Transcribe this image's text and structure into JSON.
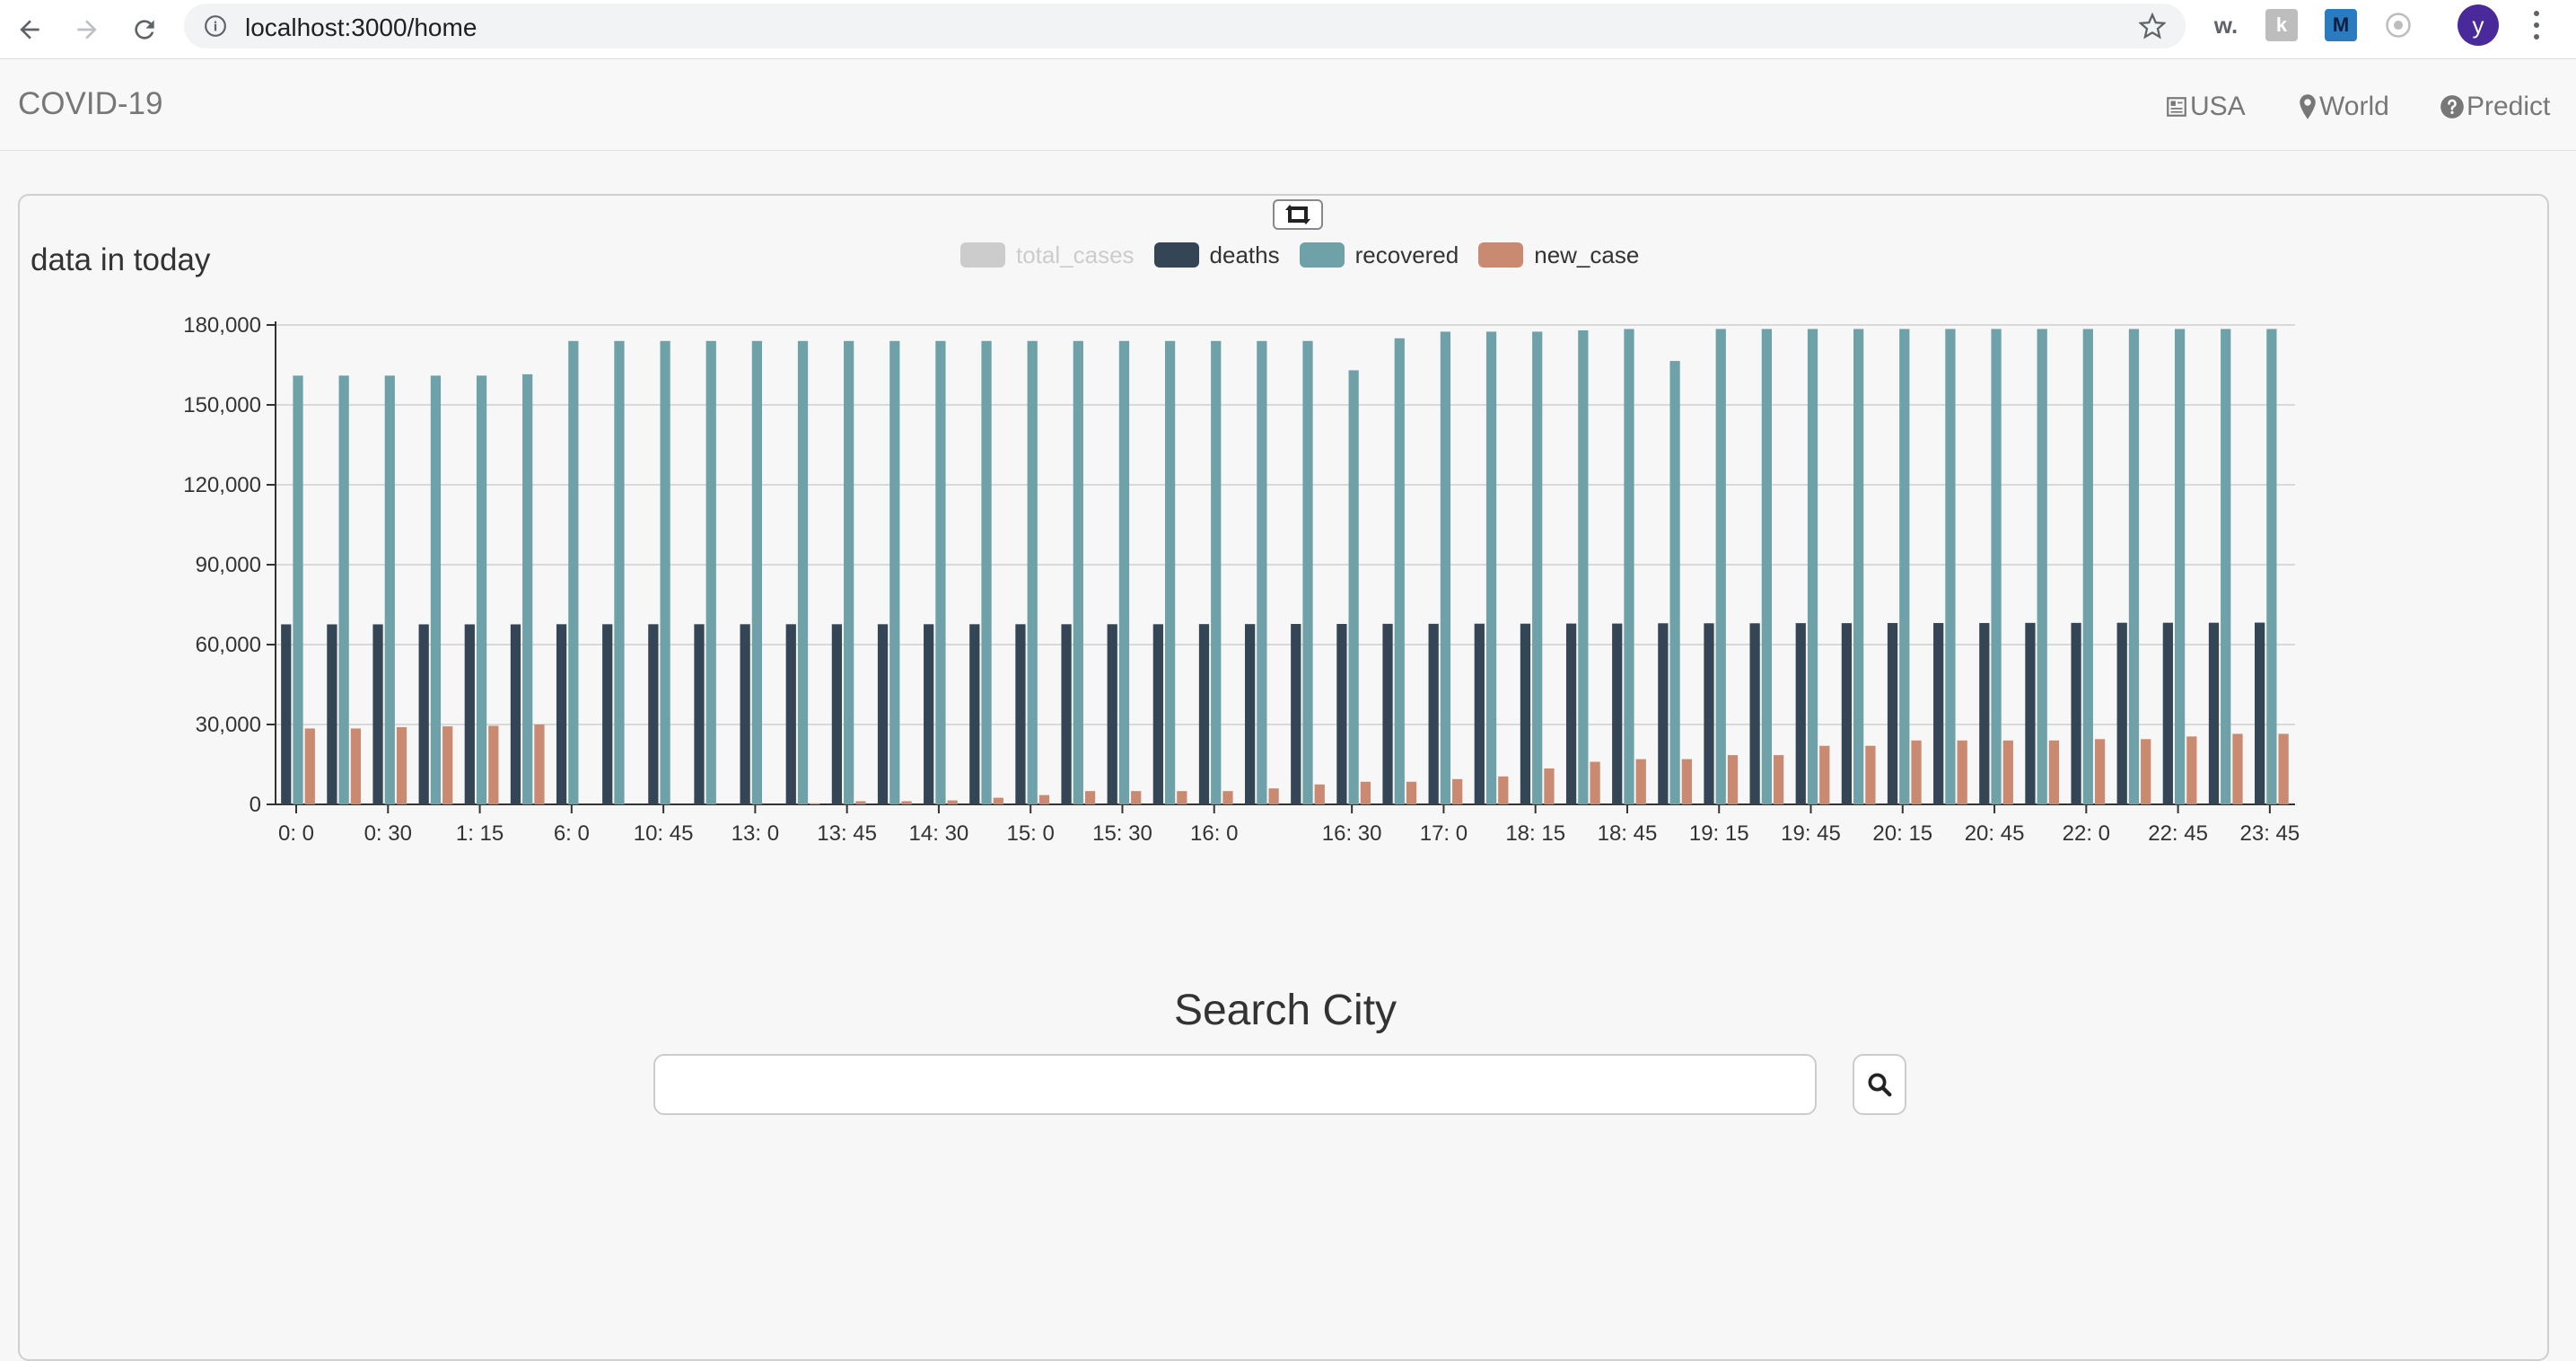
{
  "browser": {
    "url": "localhost:3000/home",
    "avatar_letter": "y",
    "extensions": [
      "w-extension-icon",
      "k-extension-icon",
      "m-extension-icon",
      "circle-extension-icon"
    ]
  },
  "navbar": {
    "brand": "COVID-19",
    "links": [
      {
        "label": "USA",
        "icon": "newspaper-icon"
      },
      {
        "label": "World",
        "icon": "map-marker-icon"
      },
      {
        "label": "Predict",
        "icon": "question-circle-icon"
      }
    ]
  },
  "panel": {
    "title": "data in today",
    "refresh_icon": "retweet-icon"
  },
  "search": {
    "title": "Search City",
    "placeholder": "",
    "value": ""
  },
  "colors": {
    "total_cases": "#cccccc",
    "deaths": "#344656",
    "recovered": "#6fa2a8",
    "new_case": "#c98a71"
  },
  "chart_data": {
    "type": "bar",
    "title": "",
    "xlabel": "",
    "ylabel": "",
    "ylim": [
      0,
      180000
    ],
    "y_ticks": [
      "0",
      "30,000",
      "60,000",
      "90,000",
      "120,000",
      "150,000",
      "180,000"
    ],
    "x_tick_labels": [
      "0: 0",
      "0: 30",
      "1: 15",
      "6: 0",
      "10: 45",
      "13: 0",
      "13: 45",
      "14: 30",
      "15: 0",
      "15: 30",
      "16: 0",
      "16: 30",
      "17: 0",
      "18: 15",
      "18: 45",
      "19: 15",
      "19: 45",
      "20: 15",
      "20: 45",
      "22: 0",
      "22: 45",
      "23: 45"
    ],
    "legend": [
      {
        "name": "total_cases",
        "color": "#cccccc",
        "disabled": true
      },
      {
        "name": "deaths",
        "color": "#344656"
      },
      {
        "name": "recovered",
        "color": "#6fa2a8"
      },
      {
        "name": "new_case",
        "color": "#c98a71"
      }
    ],
    "category_count": 44,
    "series": [
      {
        "name": "deaths",
        "values": [
          67600,
          67600,
          67600,
          67600,
          67600,
          67600,
          67650,
          67650,
          67650,
          67650,
          67650,
          67650,
          67650,
          67650,
          67650,
          67650,
          67650,
          67650,
          67650,
          67650,
          67700,
          67700,
          67750,
          67750,
          67800,
          67800,
          67850,
          67850,
          67900,
          67900,
          68000,
          68000,
          68000,
          68050,
          68050,
          68100,
          68100,
          68100,
          68150,
          68150,
          68200,
          68200,
          68200,
          68250
        ]
      },
      {
        "name": "recovered",
        "values": [
          161000,
          161000,
          161000,
          161000,
          161000,
          161500,
          174000,
          174000,
          174000,
          174000,
          174000,
          174000,
          174000,
          174000,
          174000,
          174000,
          174000,
          174000,
          174000,
          174000,
          174000,
          174000,
          174000,
          163000,
          175000,
          177500,
          177500,
          177500,
          178000,
          178500,
          166500,
          178500,
          178500,
          178500,
          178500,
          178500,
          178500,
          178500,
          178500,
          178500,
          178500,
          178500,
          178500,
          178500
        ]
      },
      {
        "name": "new_case",
        "values": [
          28500,
          28500,
          29000,
          29300,
          29500,
          30000,
          0,
          0,
          0,
          0,
          0,
          400,
          1200,
          1200,
          1500,
          2500,
          3500,
          5000,
          5000,
          5000,
          5000,
          6000,
          7500,
          8500,
          8500,
          9500,
          10500,
          13500,
          16000,
          17000,
          17000,
          18500,
          18500,
          22000,
          22000,
          24000,
          24000,
          24000,
          24000,
          24500,
          24500,
          25500,
          26500,
          26500
        ]
      }
    ]
  }
}
